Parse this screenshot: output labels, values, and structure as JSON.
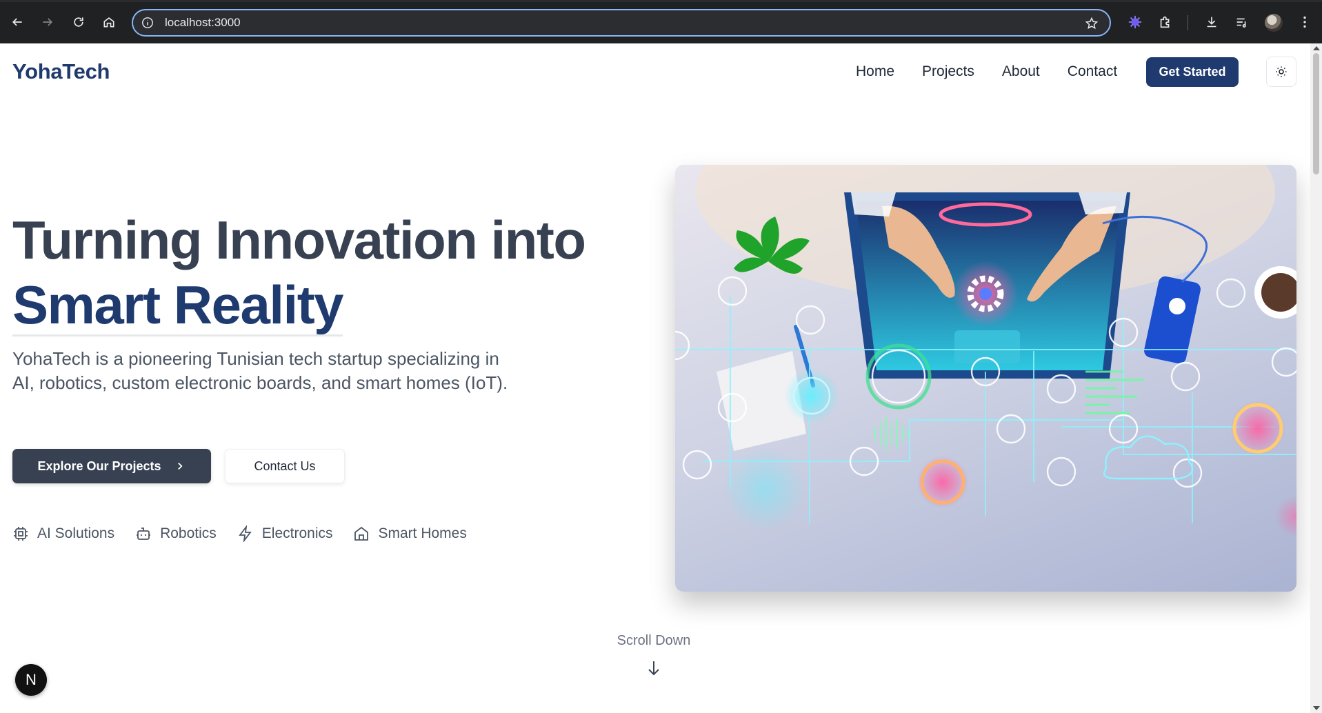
{
  "browser": {
    "url": "localhost:3000"
  },
  "header": {
    "logo": "YohaTech",
    "nav": [
      "Home",
      "Projects",
      "About",
      "Contact"
    ],
    "cta": "Get Started",
    "theme_icon": "sun-icon"
  },
  "hero": {
    "title_line1": "Turning Innovation into",
    "title_line2": "Smart Reality",
    "description": "YohaTech is a pioneering Tunisian tech startup specializing in AI, robotics, custom electronic boards, and smart homes (IoT).",
    "primary_button": "Explore Our Projects",
    "secondary_button": "Contact Us",
    "features": [
      {
        "label": "AI Solutions",
        "icon": "cpu-icon"
      },
      {
        "label": "Robotics",
        "icon": "robot-icon"
      },
      {
        "label": "Electronics",
        "icon": "lightning-icon"
      },
      {
        "label": "Smart Homes",
        "icon": "home-icon"
      }
    ]
  },
  "scroll_hint": "Scroll Down",
  "dev_badge": "N",
  "colors": {
    "brand": "#1e3a6e",
    "dark_button": "#374151",
    "omnibox_focus": "#8ab4f8"
  }
}
